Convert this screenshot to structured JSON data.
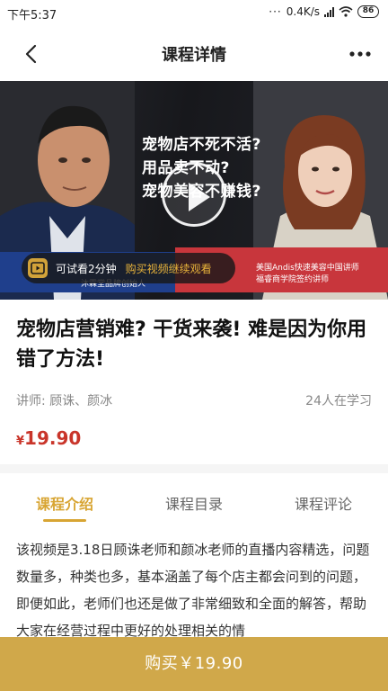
{
  "status_bar": {
    "time": "下午5:37",
    "dots": "···",
    "network_speed": "0.4K/s",
    "battery": "86"
  },
  "nav": {
    "title": "课程详情"
  },
  "hero": {
    "headline_lines": [
      "宠物店不死不活?",
      "用品卖不动?",
      "宠物美容不赚钱?"
    ],
    "left_band_text": "沐霖堂品牌创始人",
    "right_band_lines": [
      "美国Andis快速美容中国讲师",
      "福睿商学院签约讲师"
    ],
    "trial_text": "可试看2分钟",
    "trial_link": "购买视频继续观看"
  },
  "course": {
    "title": "宠物店营销难? 干货来袭! 难是因为你用错了方法!",
    "lecturer": "讲师: 顾诛、颜冰",
    "learners": "24人在学习",
    "price_symbol": "¥",
    "price_value": "19.90"
  },
  "tabs": [
    {
      "label": "课程介绍",
      "active": true
    },
    {
      "label": "课程目录",
      "active": false
    },
    {
      "label": "课程评论",
      "active": false
    }
  ],
  "intro": "该视频是3.18日顾诛老师和颜冰老师的直播内容精选，问题数量多，种类也多，基本涵盖了每个店主都会问到的问题，即便如此，老师们也还是做了非常细致和全面的解答，帮助大家在经营过程中更好的处理相关的情",
  "buy_button": "购买￥19.90",
  "colors": {
    "accent": "#d8a533",
    "buy_bar": "#d0a84a",
    "price": "#c9352a"
  }
}
